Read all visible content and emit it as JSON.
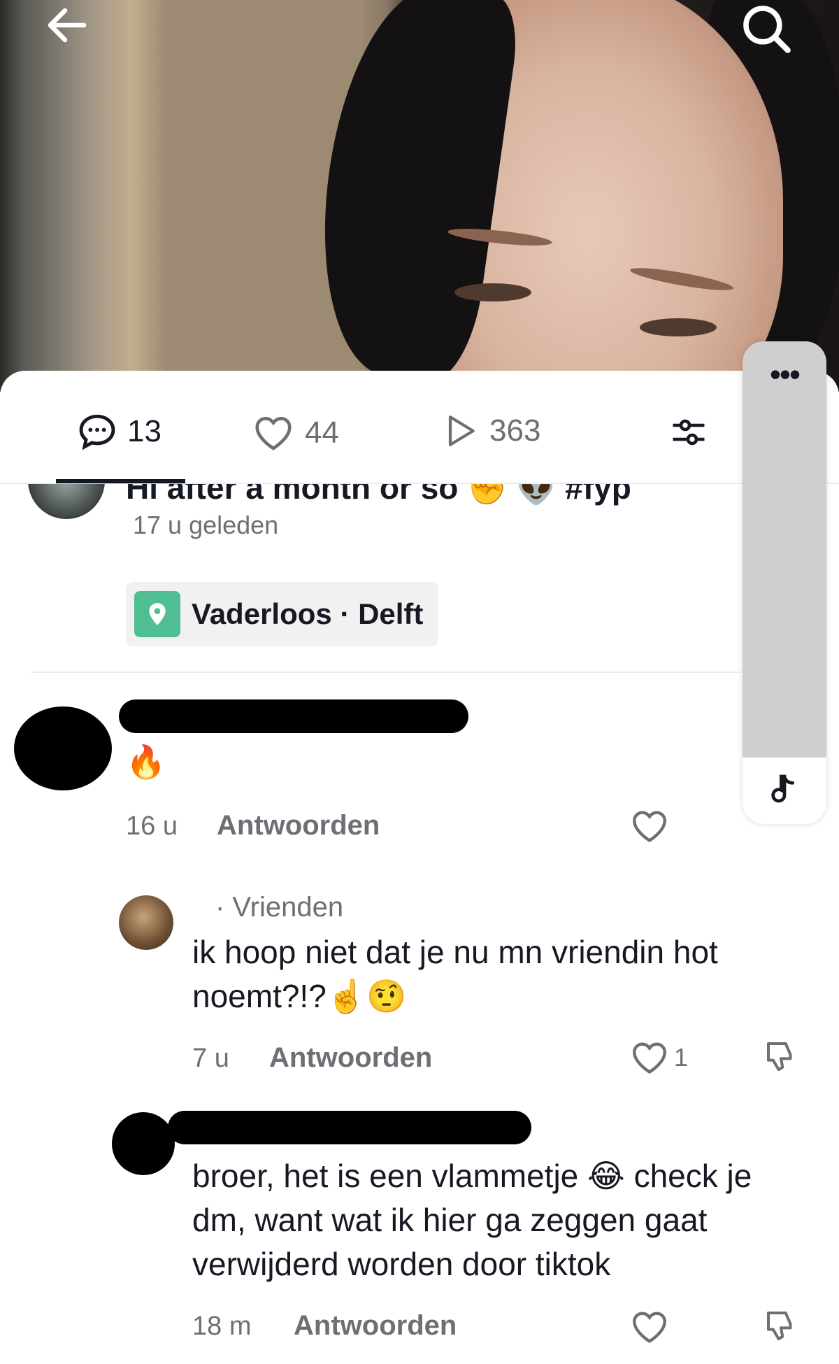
{
  "header": {
    "back_icon": "arrow-left-icon",
    "search_icon": "search-icon"
  },
  "stats": {
    "comments": "13",
    "likes": "44",
    "views": "363",
    "filter_icon": "sliders-icon"
  },
  "post": {
    "caption": "Hi after a month or so ✊ 👽 #fyp",
    "time": "17 u geleden",
    "location": "Vaderloos · Delft"
  },
  "comments": [
    {
      "text": "🔥",
      "time": "16 u",
      "reply_label": "Antwoorden",
      "likes": ""
    },
    {
      "tag": "· Vrienden",
      "text": "ik hoop niet dat je nu mn vriendin hot noemt?!?☝️🤨",
      "time": "7 u",
      "reply_label": "Antwoorden",
      "likes": "1"
    },
    {
      "text": "broer, het is een vlammetje 😂 check je dm, want wat ik hier ga zeggen gaat verwijderd worden door tiktok",
      "time": "18 m",
      "reply_label": "Antwoorden",
      "likes": ""
    }
  ],
  "side_panel": {
    "more_label": "•••",
    "music_icon": "music-note-icon"
  }
}
